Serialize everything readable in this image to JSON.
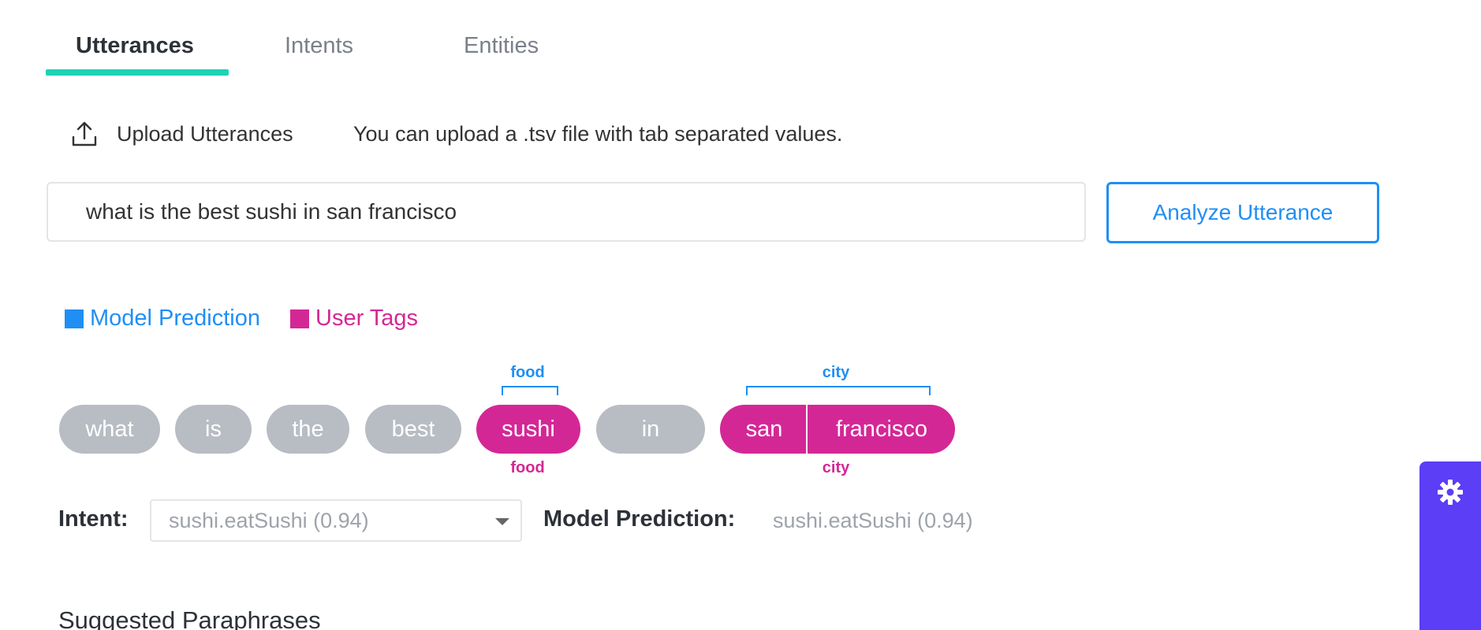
{
  "tabs": [
    {
      "label": "Utterances",
      "active": true
    },
    {
      "label": "Intents",
      "active": false
    },
    {
      "label": "Entities",
      "active": false
    }
  ],
  "upload": {
    "label": "Upload Utterances",
    "hint": "You can upload a .tsv file with tab separated values."
  },
  "utterance_input": {
    "value": "what is the best sushi in san francisco"
  },
  "analyze_button": {
    "label": "Analyze Utterance"
  },
  "legend": [
    {
      "label": "Model Prediction",
      "color": "#1f8ff5"
    },
    {
      "label": "User Tags",
      "color": "#d42796"
    }
  ],
  "tokens": [
    {
      "text": "what",
      "tagged": false
    },
    {
      "text": "is",
      "tagged": false
    },
    {
      "text": "the",
      "tagged": false
    },
    {
      "text": "best",
      "tagged": false
    },
    {
      "text": "sushi",
      "tagged": true
    },
    {
      "text": "in",
      "tagged": false
    },
    {
      "text": "san",
      "tagged": true
    },
    {
      "text": "francisco",
      "tagged": true
    }
  ],
  "entity_spans": [
    {
      "entity": "food",
      "model_label": "food",
      "user_label": "food"
    },
    {
      "entity": "city",
      "model_label": "city",
      "user_label": "city"
    }
  ],
  "intent": {
    "label": "Intent:",
    "selected": "sushi.eatSushi  (0.94)"
  },
  "model_prediction": {
    "label": "Model Prediction:",
    "value": "sushi.eatSushi  (0.94)"
  },
  "suggested": {
    "title": "Suggested Paraphrases"
  },
  "side_panel": {
    "icon": "gear-icon",
    "color": "#5b3ef6"
  }
}
